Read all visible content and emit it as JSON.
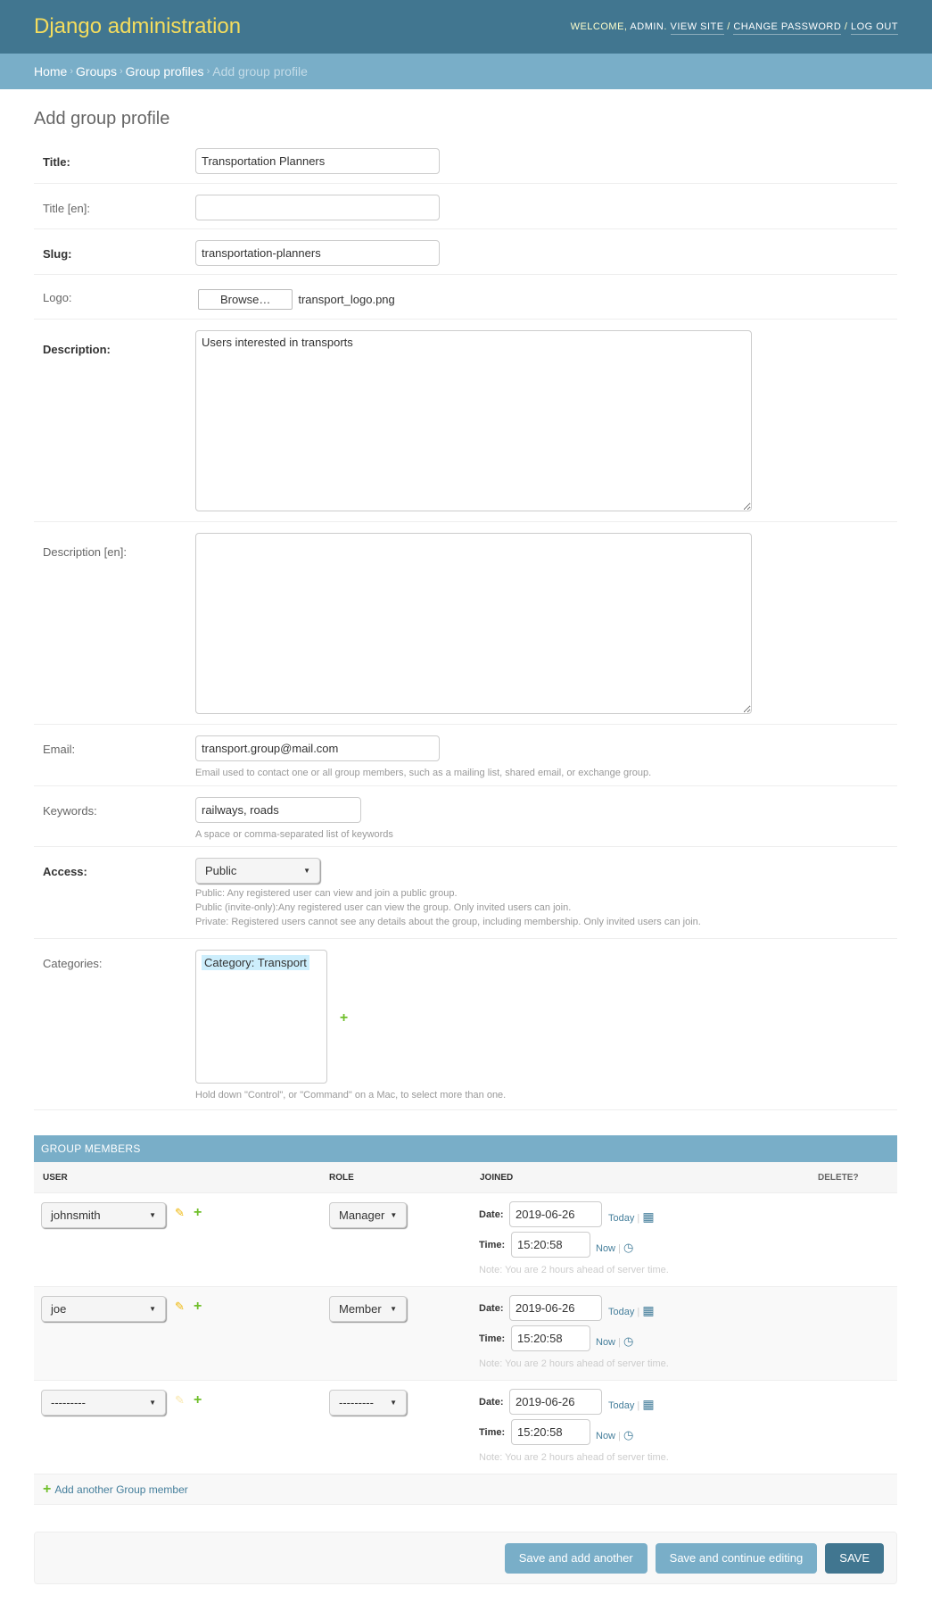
{
  "header": {
    "brand": "Django administration",
    "welcome": "Welcome,",
    "user": "admin",
    "view_site": "View site",
    "change_password": "Change password",
    "log_out": "Log out",
    "sep": "/"
  },
  "breadcrumbs": [
    "Home",
    "Groups",
    "Group profiles",
    "Add group profile"
  ],
  "page_title": "Add group profile",
  "form": {
    "title": {
      "label": "Title:",
      "value": "Transportation Planners"
    },
    "title_en": {
      "label": "Title [en]:",
      "value": ""
    },
    "slug": {
      "label": "Slug:",
      "value": "transportation-planners"
    },
    "logo": {
      "label": "Logo:",
      "button": "Browse…",
      "filename": "transport_logo.png"
    },
    "description": {
      "label": "Description:",
      "value": "Users interested in transports"
    },
    "description_en": {
      "label": "Description [en]:",
      "value": ""
    },
    "email": {
      "label": "Email:",
      "value": "transport.group@mail.com",
      "help": "Email used to contact one or all group members, such as a mailing list, shared email, or exchange group."
    },
    "keywords": {
      "label": "Keywords:",
      "value": "railways, roads",
      "help": "A space or comma-separated list of keywords"
    },
    "access": {
      "label": "Access:",
      "value": "Public",
      "help": [
        "Public: Any registered user can view and join a public group.",
        "Public (invite-only):Any registered user can view the group. Only invited users can join.",
        "Private: Registered users cannot see any details about the group, including membership. Only invited users can join."
      ]
    },
    "categories": {
      "label": "Categories:",
      "options": [
        "Category: Transport"
      ],
      "help": "Hold down \"Control\", or \"Command\" on a Mac, to select more than one."
    }
  },
  "members": {
    "title": "Group members",
    "columns": [
      "User",
      "Role",
      "Joined",
      "Delete?"
    ],
    "date_label": "Date:",
    "time_label": "Time:",
    "today": "Today",
    "now": "Now",
    "note": "Note: You are 2 hours ahead of server time.",
    "rows": [
      {
        "user": "johnsmith",
        "role": "Manager",
        "date": "2019-06-26",
        "time": "15:20:58"
      },
      {
        "user": "joe",
        "role": "Member",
        "date": "2019-06-26",
        "time": "15:20:58"
      },
      {
        "user": "---------",
        "role": "---------",
        "date": "2019-06-26",
        "time": "15:20:58"
      }
    ],
    "add_another": "Add another Group member"
  },
  "buttons": {
    "save_add": "Save and add another",
    "save_continue": "Save and continue editing",
    "save": "Save"
  },
  "colors": {
    "header": "#417690",
    "accent": "#79aec8",
    "brand": "#f5dd5d",
    "add": "#70bf2b",
    "edit": "#efb80b"
  }
}
